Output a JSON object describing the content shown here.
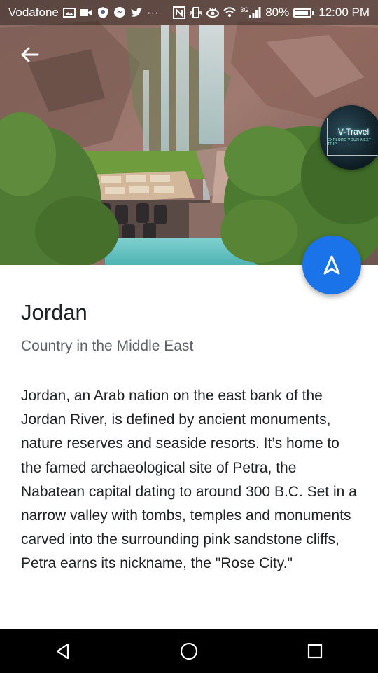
{
  "status_bar": {
    "carrier": "Vodafone",
    "overflow": "···",
    "network_type": "3G",
    "battery_percent": "80%",
    "battery_level": 0.8,
    "time": "12:00 PM"
  },
  "badge": {
    "title": "V-Travel",
    "subtitle": "EXPLORE YOUR NEXT TRIP"
  },
  "place": {
    "title": "Jordan",
    "subtitle": "Country in the Middle East",
    "description": "Jordan, an Arab nation on the east bank of the Jordan River, is defined by ancient monuments, nature reserves and seaside resorts. It’s home to the famed archaeological site of Petra, the Nabatean capital dating to around 300 B.C. Set in a narrow valley with tombs, temples and monuments carved into the surrounding pink sandstone cliffs, Petra earns its nickname, the \"Rose City.\""
  },
  "colors": {
    "accent": "#1a73e8",
    "text_primary": "#202124",
    "text_secondary": "#5f6368"
  },
  "icons": {
    "back": "arrow-left-icon",
    "fab": "navigation-arrow-icon",
    "nav_back": "triangle-back-icon",
    "nav_home": "circle-home-icon",
    "nav_recents": "square-recents-icon"
  }
}
